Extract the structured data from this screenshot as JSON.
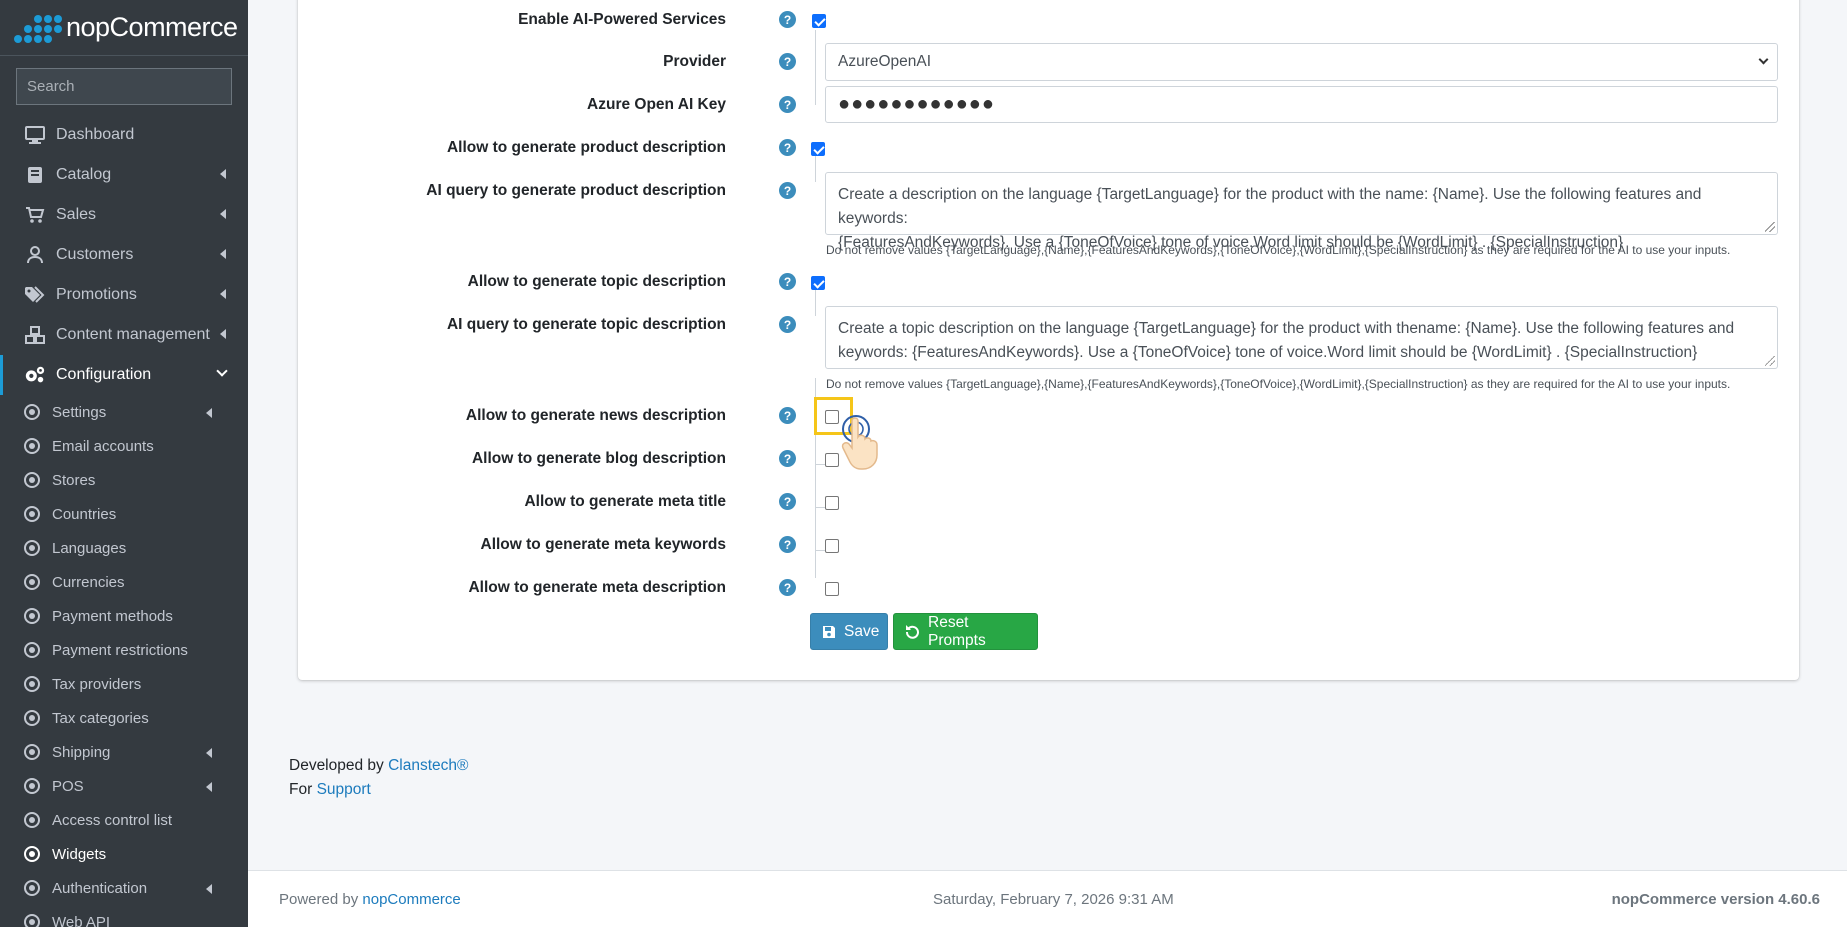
{
  "brand": {
    "name": "nopCommerce"
  },
  "search": {
    "placeholder": "Search"
  },
  "sidebar": {
    "nav": [
      {
        "label": "Dashboard",
        "icon": "monitor-icon"
      },
      {
        "label": "Catalog",
        "icon": "book-icon"
      },
      {
        "label": "Sales",
        "icon": "cart-icon"
      },
      {
        "label": "Customers",
        "icon": "user-icon"
      },
      {
        "label": "Promotions",
        "icon": "tags-icon"
      },
      {
        "label": "Content management",
        "icon": "cubes-icon"
      },
      {
        "label": "Configuration",
        "icon": "gears-icon"
      }
    ],
    "sub": [
      "Settings",
      "Email accounts",
      "Stores",
      "Countries",
      "Languages",
      "Currencies",
      "Payment methods",
      "Payment restrictions",
      "Tax providers",
      "Tax categories",
      "Shipping",
      "POS",
      "Access control list",
      "Widgets",
      "Authentication",
      "Web API"
    ]
  },
  "form": {
    "enable_ai": {
      "label": "Enable AI-Powered Services",
      "checked": true
    },
    "provider": {
      "label": "Provider",
      "value": "AzureOpenAI"
    },
    "azure_key": {
      "label": "Azure Open AI Key",
      "value": "●●●●●●●●●●●●"
    },
    "allow_product": {
      "label": "Allow to generate product description",
      "checked": true
    },
    "product_query": {
      "label": "AI query to generate product description",
      "line1": "Create a description on the language {TargetLanguage} for the product with the name: {Name}. Use the following features and keywords:",
      "line2": "{FeaturesAndKeywords}. Use a {ToneOfVoice} tone of voice.Word limit should be {WordLimit} . {SpecialInstruction}",
      "hint": "Do not remove values {TargetLanguage},{Name},{FeaturesAndKeywords},{ToneOfVoice},{WordLimit},{SpecialInstruction} as they are required for the AI to use your inputs."
    },
    "allow_topic": {
      "label": "Allow to generate topic description",
      "checked": true
    },
    "topic_query": {
      "label": "AI query to generate topic description",
      "line1": "Create a topic description on the language {TargetLanguage} for the product with thename: {Name}. Use the following features and",
      "line2": "keywords: {FeaturesAndKeywords}. Use a {ToneOfVoice} tone of voice.Word limit should be {WordLimit} . {SpecialInstruction}",
      "hint": "Do not remove values {TargetLanguage},{Name},{FeaturesAndKeywords},{ToneOfVoice},{WordLimit},{SpecialInstruction} as they are required for the AI to use your inputs."
    },
    "allow_news": {
      "label": "Allow to generate news description",
      "checked": false
    },
    "allow_blog": {
      "label": "Allow to generate blog description",
      "checked": false
    },
    "allow_meta_title": {
      "label": "Allow to generate meta title",
      "checked": false
    },
    "allow_meta_keywords": {
      "label": "Allow to generate meta keywords",
      "checked": false
    },
    "allow_meta_description": {
      "label": "Allow to generate meta description",
      "checked": false
    },
    "help_glyph": "?",
    "save_label": "Save",
    "reset_label": "Reset Prompts"
  },
  "credits": {
    "developed_by": "Developed by",
    "developer": "Clanstech®",
    "for": "For",
    "support": "Support"
  },
  "footer": {
    "powered_by": "Powered by",
    "powered_link": "nopCommerce",
    "datetime": "Saturday, February 7, 2026 9:31 AM",
    "version": "nopCommerce version 4.60.6"
  },
  "colors": {
    "sidebar": "#343a40",
    "accent": "#3c8dbc",
    "success": "#28a745",
    "highlight": "#f5c518"
  }
}
